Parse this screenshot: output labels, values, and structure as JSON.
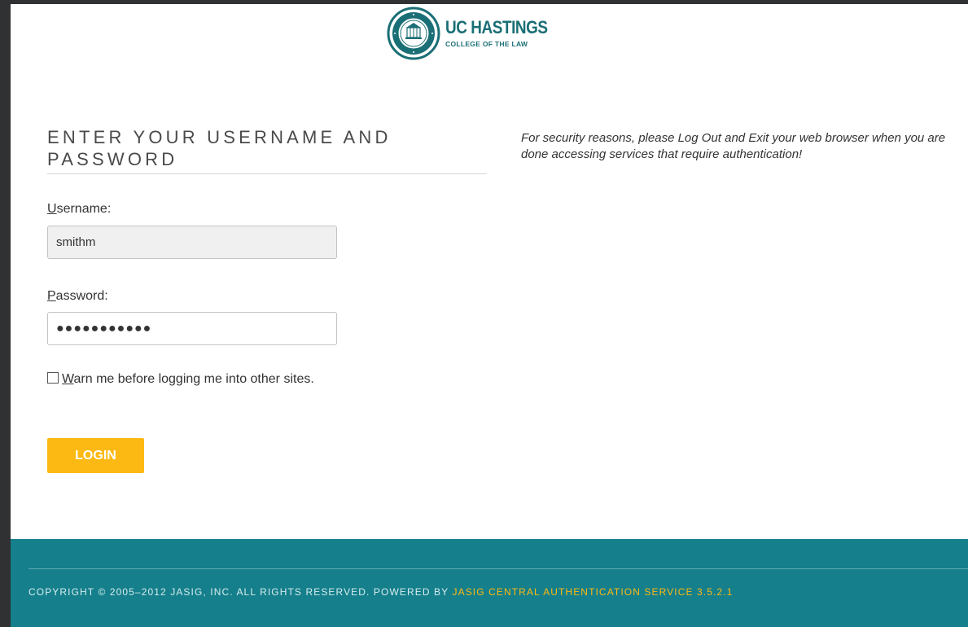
{
  "header": {
    "logo_title": "UC HASTINGS",
    "logo_subtitle": "COLLEGE OF THE LAW"
  },
  "login": {
    "heading": "ENTER YOUR USERNAME AND PASSWORD",
    "username_label_access": "U",
    "username_label_rest": "sername:",
    "username_value": "smithm",
    "password_label_access": "P",
    "password_label_rest": "assword:",
    "password_value": "●●●●●●●●●●●",
    "warn_access": "W",
    "warn_rest": "arn me before logging me into other sites.",
    "warn_checked": false,
    "login_button": "LOGIN"
  },
  "notice": {
    "text": "For security reasons, please Log Out and Exit your web browser when you are done accessing services that require authentication!"
  },
  "footer": {
    "copyright": "COPYRIGHT © 2005–2012 JASIG, INC. ALL RIGHTS RESERVED. POWERED BY ",
    "link_text": "JASIG CENTRAL AUTHENTICATION SERVICE 3.5.2.1"
  },
  "colors": {
    "brand_teal": "#1a6e75",
    "footer_teal": "#157f8b",
    "button_yellow": "#fdb913"
  }
}
